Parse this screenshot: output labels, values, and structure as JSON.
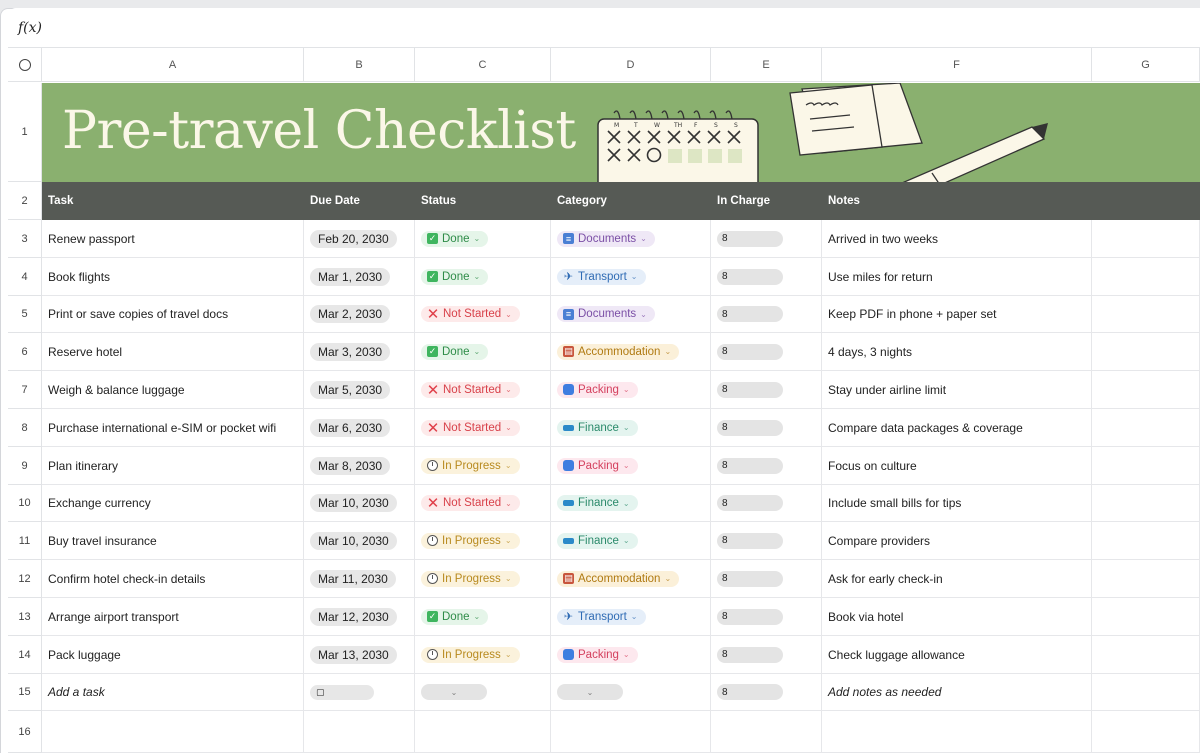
{
  "formula_bar": {
    "label": "f(x)"
  },
  "columns": [
    "A",
    "B",
    "C",
    "D",
    "E",
    "F",
    "G"
  ],
  "banner": {
    "title": "Pre-travel Checklist"
  },
  "headers": {
    "task": "Task",
    "due": "Due Date",
    "status": "Status",
    "category": "Category",
    "in_charge": "In Charge",
    "notes": "Notes"
  },
  "rows": [
    {
      "num": "3",
      "task": "Renew passport",
      "due": "Feb 20, 2030",
      "status": "Done",
      "status_type": "done",
      "category": "Documents",
      "cat_type": "doc",
      "notes": "Arrived in two weeks"
    },
    {
      "num": "4",
      "task": "Book flights",
      "due": "Mar 1, 2030",
      "status": "Done",
      "status_type": "done",
      "category": "Transport",
      "cat_type": "trans",
      "notes": "Use miles for return"
    },
    {
      "num": "5",
      "task": "Print or save copies of travel docs",
      "due": "Mar 2, 2030",
      "status": "Not Started",
      "status_type": "not",
      "category": "Documents",
      "cat_type": "doc",
      "notes": "Keep PDF in phone + paper set"
    },
    {
      "num": "6",
      "task": "Reserve hotel",
      "due": "Mar 3, 2030",
      "status": "Done",
      "status_type": "done",
      "category": "Accommodation",
      "cat_type": "acc",
      "notes": "4 days, 3 nights"
    },
    {
      "num": "7",
      "task": "Weigh & balance luggage",
      "due": "Mar 5, 2030",
      "status": "Not Started",
      "status_type": "not",
      "category": "Packing",
      "cat_type": "pack",
      "notes": "Stay under airline limit"
    },
    {
      "num": "8",
      "task": "Purchase international e-SIM or pocket wifi",
      "due": "Mar 6, 2030",
      "status": "Not Started",
      "status_type": "not",
      "category": "Finance",
      "cat_type": "fin",
      "notes": "Compare data packages & coverage"
    },
    {
      "num": "9",
      "task": "Plan itinerary",
      "due": "Mar 8, 2030",
      "status": "In Progress",
      "status_type": "prog",
      "category": "Packing",
      "cat_type": "pack",
      "notes": "Focus on culture"
    },
    {
      "num": "10",
      "task": "Exchange currency",
      "due": "Mar 10, 2030",
      "status": "Not Started",
      "status_type": "not",
      "category": "Finance",
      "cat_type": "fin",
      "notes": "Include small bills for tips"
    },
    {
      "num": "11",
      "task": "Buy travel insurance",
      "due": "Mar 10, 2030",
      "status": "In Progress",
      "status_type": "prog",
      "category": "Finance",
      "cat_type": "fin",
      "notes": "Compare providers"
    },
    {
      "num": "12",
      "task": "Confirm hotel check-in details",
      "due": "Mar 11, 2030",
      "status": "In Progress",
      "status_type": "prog",
      "category": "Accommodation",
      "cat_type": "acc",
      "notes": "Ask for early check-in"
    },
    {
      "num": "13",
      "task": "Arrange airport transport",
      "due": "Mar 12, 2030",
      "status": "Done",
      "status_type": "done",
      "category": "Transport",
      "cat_type": "trans",
      "notes": "Book via hotel"
    },
    {
      "num": "14",
      "task": "Pack luggage",
      "due": "Mar 13, 2030",
      "status": "In Progress",
      "status_type": "prog",
      "category": "Packing",
      "cat_type": "pack",
      "notes": "Check luggage allowance"
    }
  ],
  "add_row": {
    "num": "15",
    "task": "Add a task",
    "notes": "Add notes as needed"
  },
  "empty_row": {
    "num": "16"
  },
  "row_labels": {
    "r1": "1",
    "r2": "2"
  },
  "icons": {
    "done": "check-icon",
    "not": "x-icon",
    "prog": "clock-icon",
    "doc": "document-icon",
    "trans": "airplane-icon",
    "acc": "hotel-icon",
    "pack": "luggage-icon",
    "fin": "credit-card-icon",
    "person": "person-icon"
  }
}
